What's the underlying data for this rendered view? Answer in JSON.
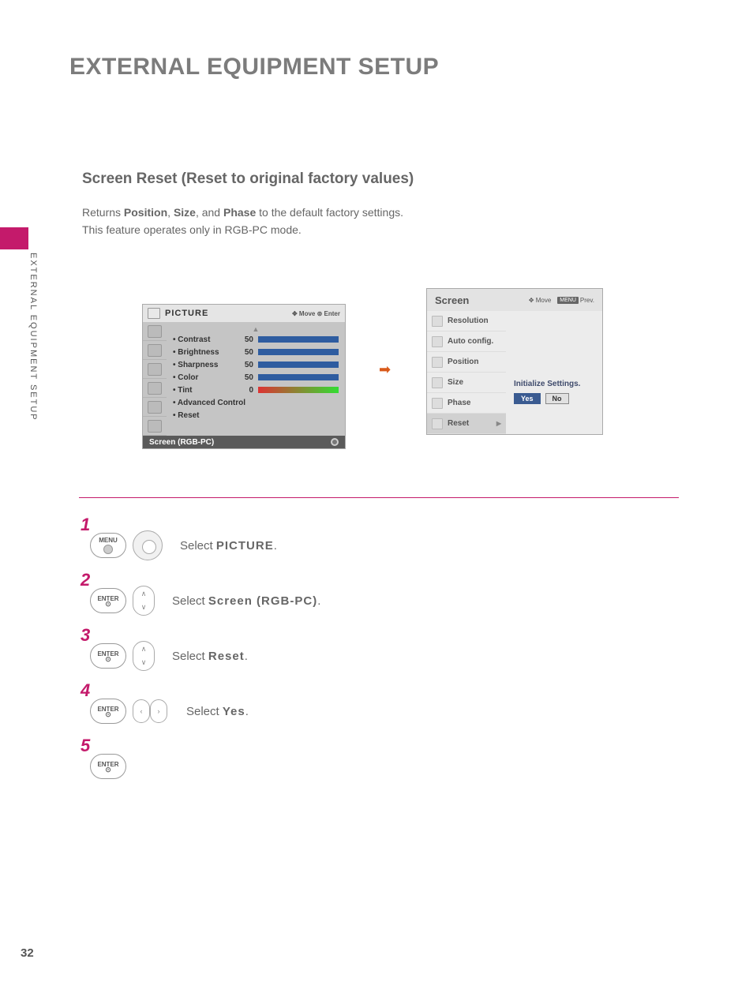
{
  "page": {
    "title": "EXTERNAL EQUIPMENT SETUP",
    "side_tab": "EXTERNAL EQUIPMENT SETUP",
    "number": "32"
  },
  "section": {
    "title": "Screen Reset (Reset to original factory values)",
    "desc_prefix": "Returns ",
    "b1": "Position",
    "c1": ", ",
    "b2": "Size",
    "c2": ", and ",
    "b3": "Phase",
    "desc_suffix": " to the default factory settings.",
    "line2": "This feature operates only in RGB-PC mode."
  },
  "picture_menu": {
    "title": "PICTURE",
    "hint_move": "Move",
    "hint_enter": "Enter",
    "items": [
      {
        "label": "• Contrast",
        "val": "50"
      },
      {
        "label": "• Brightness",
        "val": "50"
      },
      {
        "label": "• Sharpness",
        "val": "50"
      },
      {
        "label": "• Color",
        "val": "50"
      },
      {
        "label": "• Tint",
        "val": "0"
      }
    ],
    "adv": "• Advanced Control",
    "reset": "• Reset",
    "selected": "Screen (RGB-PC)"
  },
  "screen_menu": {
    "title": "Screen",
    "hint_move": "Move",
    "hint_menu": "MENU",
    "hint_prev": "Prev.",
    "items": [
      "Resolution",
      "Auto config.",
      "Position",
      "Size",
      "Phase",
      "Reset"
    ],
    "msg": "Initialize Settings.",
    "yes": "Yes",
    "no": "No"
  },
  "steps": [
    {
      "num": "1",
      "btn": "MENU",
      "pad": "dpad",
      "text_pre": "Select ",
      "bold": "PICTURE",
      "text_post": "."
    },
    {
      "num": "2",
      "btn": "ENTER",
      "pad": "vpad",
      "text_pre": "Select ",
      "bold": "Screen (RGB-PC)",
      "text_post": "."
    },
    {
      "num": "3",
      "btn": "ENTER",
      "pad": "vpad",
      "text_pre": "Select ",
      "bold": "Reset",
      "text_post": "."
    },
    {
      "num": "4",
      "btn": "ENTER",
      "pad": "hpad",
      "text_pre": "Select ",
      "bold": "Yes",
      "text_post": "."
    },
    {
      "num": "5",
      "btn": "ENTER",
      "pad": "",
      "text_pre": "",
      "bold": "",
      "text_post": ""
    }
  ]
}
